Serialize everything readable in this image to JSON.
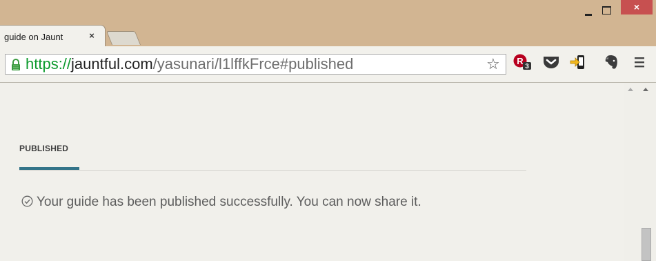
{
  "browser": {
    "tab_title": "guide on Jaunt",
    "tab_close": "×",
    "window_minimize": "_",
    "window_close": "×",
    "url": {
      "scheme": "https://",
      "host": "jauntful.com",
      "path": "/yasunari/l1lffkFrce#published"
    },
    "bookmark_star": "☆",
    "extensions": [
      "rakuten-extension-icon",
      "pocket-icon",
      "pushbullet-icon",
      "evernote-icon"
    ],
    "rakuten_badge": "3",
    "menu_icon": "hamburger-menu-icon"
  },
  "page": {
    "section_title": "PUBLISHED",
    "success_message": "Your guide has been published successfully. You can now share it."
  },
  "colors": {
    "titlebar": "#d2b592",
    "accent": "#347489",
    "secure": "#0b9a2c",
    "close": "#c75050"
  }
}
